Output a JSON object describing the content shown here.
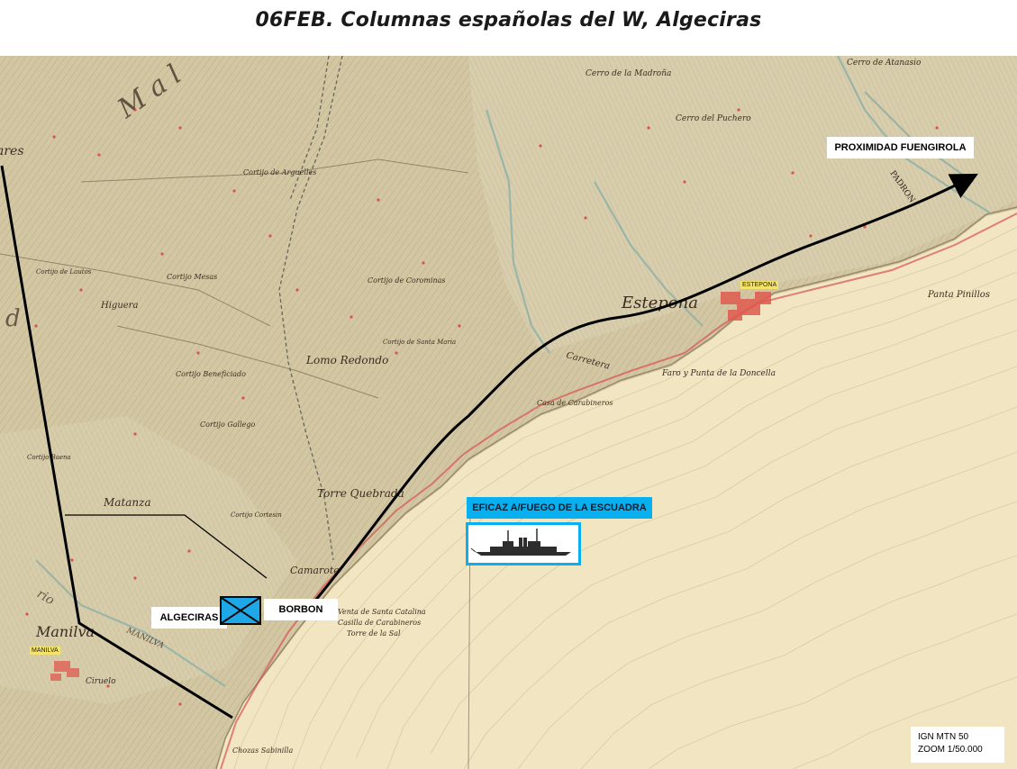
{
  "title": "06FEB. Columnas españolas del W, Algeciras",
  "labels": {
    "proximity": "PROXIMIDAD FUENGIROLA",
    "algeciras": "ALGECIRAS",
    "borbon": "BORBON",
    "escuadra": "EFICAZ A/FUEGO DE LA ESCUADRA"
  },
  "ign": {
    "line1": "IGN MTN 50",
    "line2": "ZOOM 1/50.000"
  },
  "towns": {
    "estepona_tag": "ESTEPONA",
    "manilva_tag": "MANILVA"
  },
  "map_text": {
    "estepona": "Estepona",
    "manilva": "Manilva",
    "lomo_redondo": "Lomo Redondo",
    "torre_quebrada": "Torre Quebrada",
    "matanza": "Matanza",
    "camarote": "Camarote",
    "carretera": "Carretera",
    "punta_doncella": "Faro y Punta de la Doncella",
    "panta_pinillos": "Panta Pinillos",
    "cerro_puchero": "Cerro del Puchero",
    "cerro_madrona": "Cerro de la Madroña",
    "cerro_atanasio": "Cerro de Atanasio",
    "higuera": "Higuera",
    "ciruelo": "Ciruelo",
    "chozas": "Chozas Sabinilla",
    "venta": "Venta de Santa Catalina",
    "casilla": "Casilla de Carabineros",
    "torre_sal": "Torre de la Sal",
    "casa_carabineros": "Casa de Carabineros",
    "padron": "PADRON",
    "cortijo_arguelles": "Cortijo de Arguelles",
    "cortijo_santa_maria": "Cortijo de Santa Maria",
    "cortijo_beneficiado": "Cortijo Beneficiado",
    "cortijo_gallego": "Cortijo Gallego",
    "cortijo_mesas": "Cortijo Mesas",
    "cortijo_corominas": "Cortijo de Corominas",
    "cortijo_cortesin": "Cortijo Cortesin",
    "cortijo_baena": "Cortijo Baena",
    "cortijo_lautos": "Cortijo de Lautos"
  },
  "colors": {
    "sea": "#f1e5c2",
    "land": "#d6ccaa",
    "route": "#000000",
    "accent_blue": "#08b0ef",
    "town_red": "#e24545",
    "river": "#8fb0a8"
  },
  "icons": {
    "unit": "infantry-unit-symbol",
    "ship": "warship-silhouette"
  }
}
